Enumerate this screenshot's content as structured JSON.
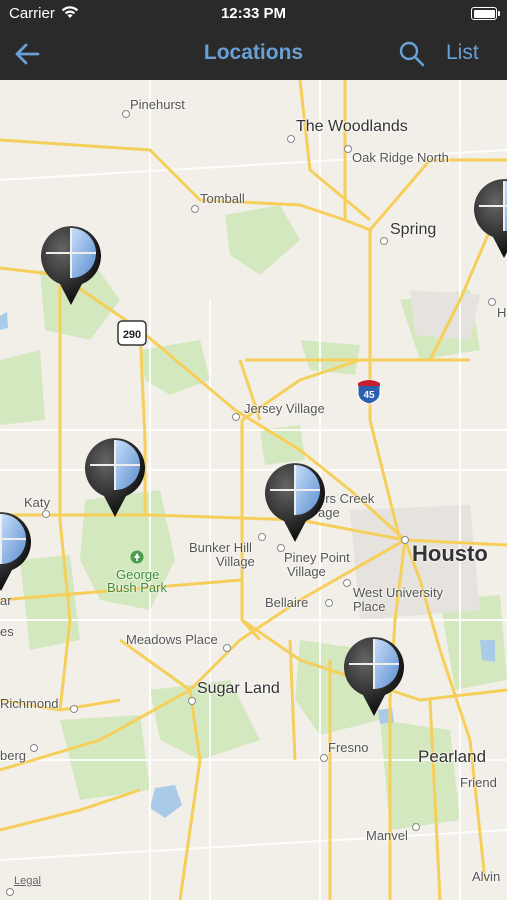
{
  "status_bar": {
    "carrier": "Carrier",
    "time": "12:33 PM"
  },
  "nav": {
    "title": "Locations",
    "list_label": "List",
    "back_icon": "back-arrow-icon",
    "search_icon": "search-icon"
  },
  "colors": {
    "bar_bg": "#2a2a2a",
    "accent": "#6aa0d4",
    "map_bg": "#f2efe9",
    "road": "#f6cf5a",
    "park": "#cfe6b6",
    "water": "#a9cbe8"
  },
  "map": {
    "labels": {
      "pinehurst": "Pinehurst",
      "the_woodlands": "The Woodlands",
      "oak_ridge_north": "Oak Ridge North",
      "tomball": "Tomball",
      "spring": "Spring",
      "jersey_village": "Jersey Village",
      "katy": "Katy",
      "bunker_hill_1": "Bunker Hill",
      "bunker_hill_2": "Village",
      "piney_point_1": "Piney Point",
      "piney_point_2": "Village",
      "hunters_creek": "ers Creek",
      "hunters_creek_2": "age",
      "houston": "Housto",
      "george_bush_1": "George",
      "george_bush_2": "Bush Park",
      "west_university_1": "West University",
      "west_university_2": "Place",
      "bellaire": "Bellaire",
      "meadows_place": "Meadows Place",
      "sugar_land": "Sugar Land",
      "richmond": "Richmond",
      "fresno": "Fresno",
      "pearland": "Pearland",
      "friendswood": "Friend",
      "manvel": "Manvel",
      "alvin": "Alvin",
      "rosenberg": "berg",
      "fulshear": "ar",
      "edge_es": "es",
      "edge_h": "H"
    },
    "shields": {
      "us290": "290",
      "i45": "45"
    },
    "legal": "Legal",
    "pin_icon": "location-pin-icon"
  }
}
